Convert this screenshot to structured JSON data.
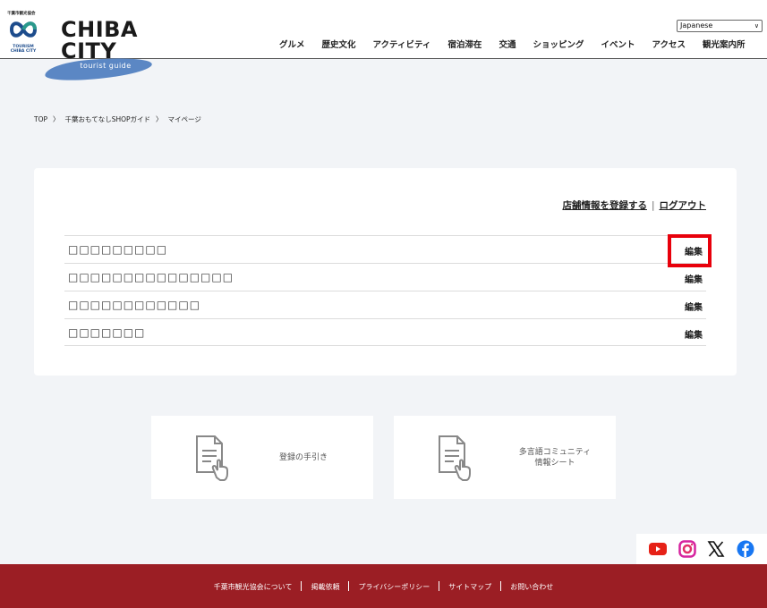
{
  "header": {
    "association_label": "千葉市観光協会",
    "tourism_label_1": "TOURISM",
    "tourism_label_2": "CHIBA CITY",
    "brand_line1": "CHIBA",
    "brand_line2": "CITY",
    "tagline": "tourist guide",
    "brand_color": "#5b87c4",
    "language": "Japanese",
    "nav": [
      "グルメ",
      "歴史文化",
      "アクティビティ",
      "宿泊滞在",
      "交通",
      "ショッピング",
      "イベント",
      "アクセス",
      "観光案内所"
    ]
  },
  "breadcrumb": {
    "top": "TOP",
    "guide": "千葉おもてなしSHOPガイド",
    "current": "マイページ"
  },
  "card": {
    "register_link": "店舗情報を登録する",
    "logout_link": "ログアウト",
    "shops": [
      {
        "name": "□□□□□□□□□",
        "edit": "編集"
      },
      {
        "name": "□□□□□□□□□□□□□□□",
        "edit": "編集"
      },
      {
        "name": "□□□□□□□□□□□□",
        "edit": "編集"
      },
      {
        "name": "□□□□□□□",
        "edit": "編集"
      }
    ],
    "highlight_color": "#e8000b"
  },
  "guides": [
    {
      "label": "登録の手引き",
      "icon": "document-hand-icon"
    },
    {
      "label": "多言語コミュニティ\n情報シート",
      "icon": "document-hand-icon"
    }
  ],
  "social": [
    "youtube-icon",
    "instagram-icon",
    "x-icon",
    "facebook-icon"
  ],
  "footer": {
    "color": "#9b1e24",
    "links": [
      "千葉市観光協会について",
      "掲載依頼",
      "プライバシーポリシー",
      "サイトマップ",
      "お問い合わせ"
    ]
  }
}
